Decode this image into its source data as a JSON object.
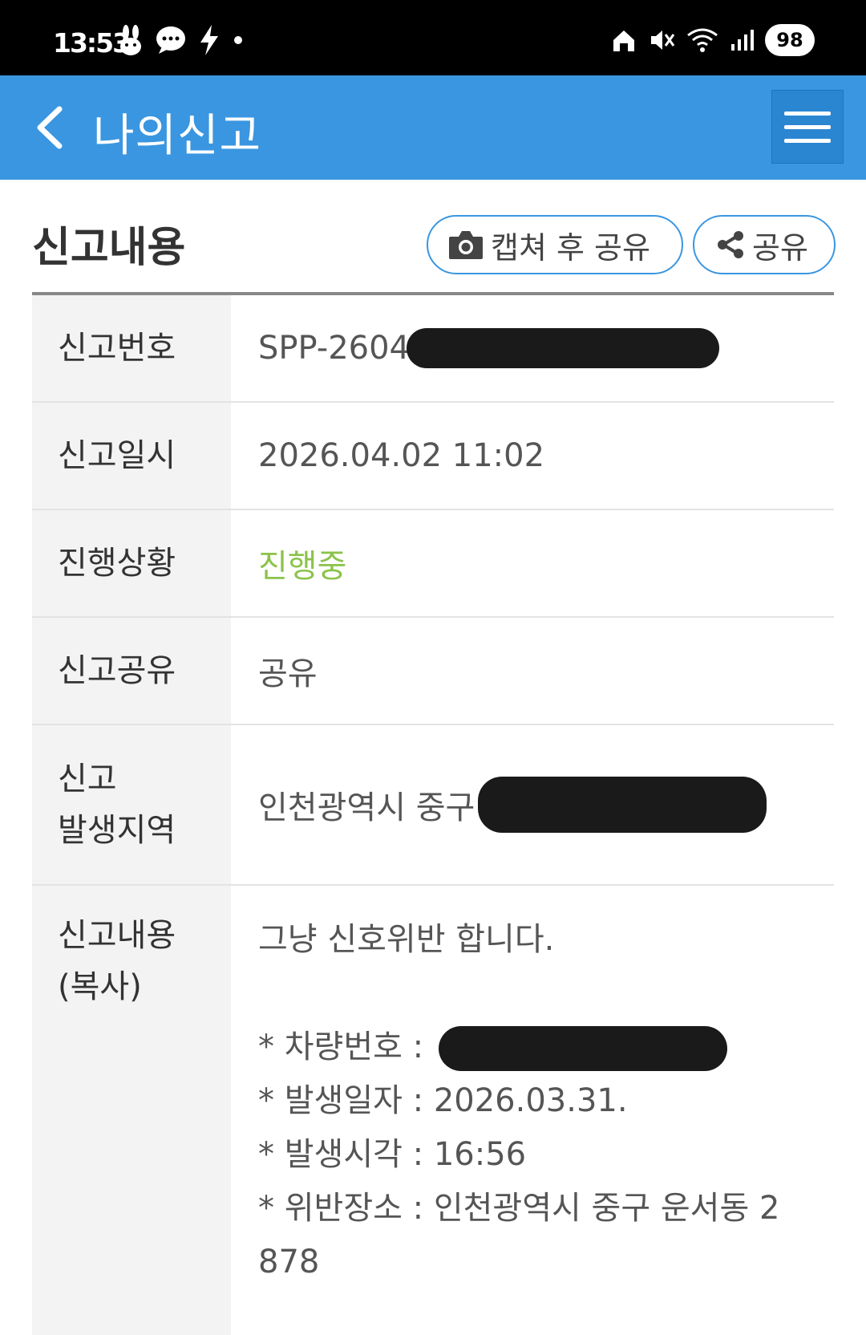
{
  "status_bar": {
    "time": "13:53",
    "battery": "98"
  },
  "header": {
    "title": "나의신고"
  },
  "section": {
    "title": "신고내용",
    "capture_share_label": "캡쳐 후 공유",
    "share_label": "공유"
  },
  "rows": {
    "report_number": {
      "label": "신고번호",
      "value": "SPP-2604"
    },
    "report_date": {
      "label": "신고일시",
      "value": "2026.04.02 11:02"
    },
    "progress": {
      "label": "진행상황",
      "value": "진행중"
    },
    "sharing": {
      "label": "신고공유",
      "value": "공유"
    },
    "region": {
      "label_line1": "신고",
      "label_line2": "발생지역",
      "value": "인천광역시 중구"
    },
    "content": {
      "label_line1": "신고내용",
      "label_line2": "(복사)",
      "text": "그냥 신호위반 합니다.",
      "vehicle_label": "* 차량번호 :",
      "date_line": "* 발생일자 : 2026.03.31.",
      "time_line": "* 발생시각 : 16:56",
      "place_line1": "* 위반장소 : 인천광역시 중구 운서동 2",
      "place_line2": "878"
    }
  },
  "colors": {
    "header_bg": "#3a96e0",
    "progress_text": "#8bc34a"
  }
}
